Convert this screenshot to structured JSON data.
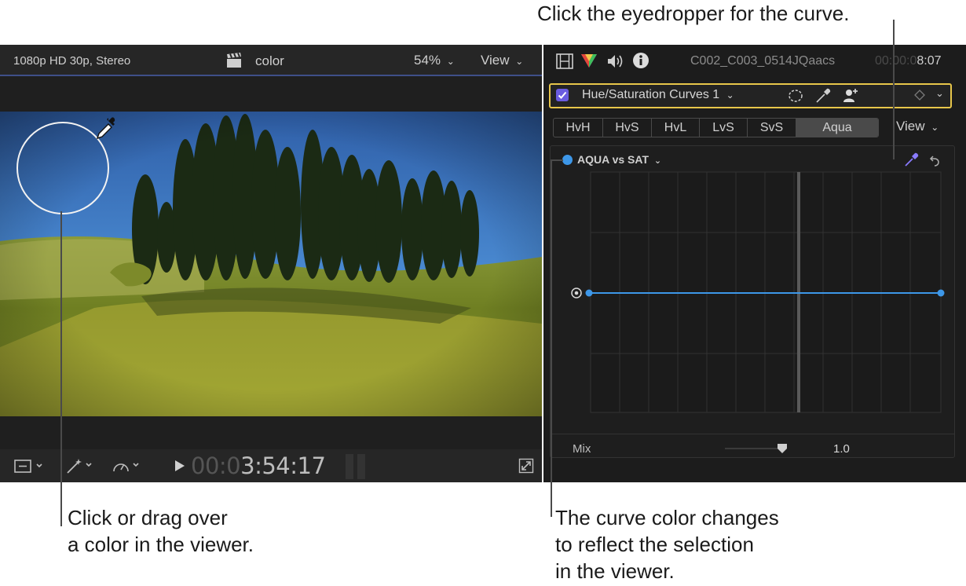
{
  "callouts": {
    "eyedropper": "Click the eyedropper for the curve.",
    "viewer": "Click or drag over\na color in the viewer.",
    "curve": "The curve color changes\nto reflect the selection\nin the viewer."
  },
  "viewer": {
    "format": "1080p HD 30p, Stereo",
    "project": "color",
    "zoom": "54%",
    "view_label": "View",
    "timecode_dim": "00:0",
    "timecode": "3:54:17"
  },
  "inspector": {
    "clip_name": "C002_C003_0514JQaacs",
    "duration_dim": "00:00:0",
    "duration": "8:07",
    "effect_name": "Hue/Saturation Curves 1",
    "tabs": [
      {
        "label": "HvH"
      },
      {
        "label": "HvS"
      },
      {
        "label": "HvL"
      },
      {
        "label": "LvS"
      },
      {
        "label": "SvS"
      },
      {
        "label": "Aqua"
      }
    ],
    "view_label": "View",
    "curve_label": "AQUA vs SAT",
    "mix_label": "Mix",
    "mix_value": "1.0",
    "mix_level": 1.0
  },
  "colors": {
    "curve": "#3d97e8",
    "highlight": "#e7c64a",
    "checkbox": "#6a5ce0"
  }
}
